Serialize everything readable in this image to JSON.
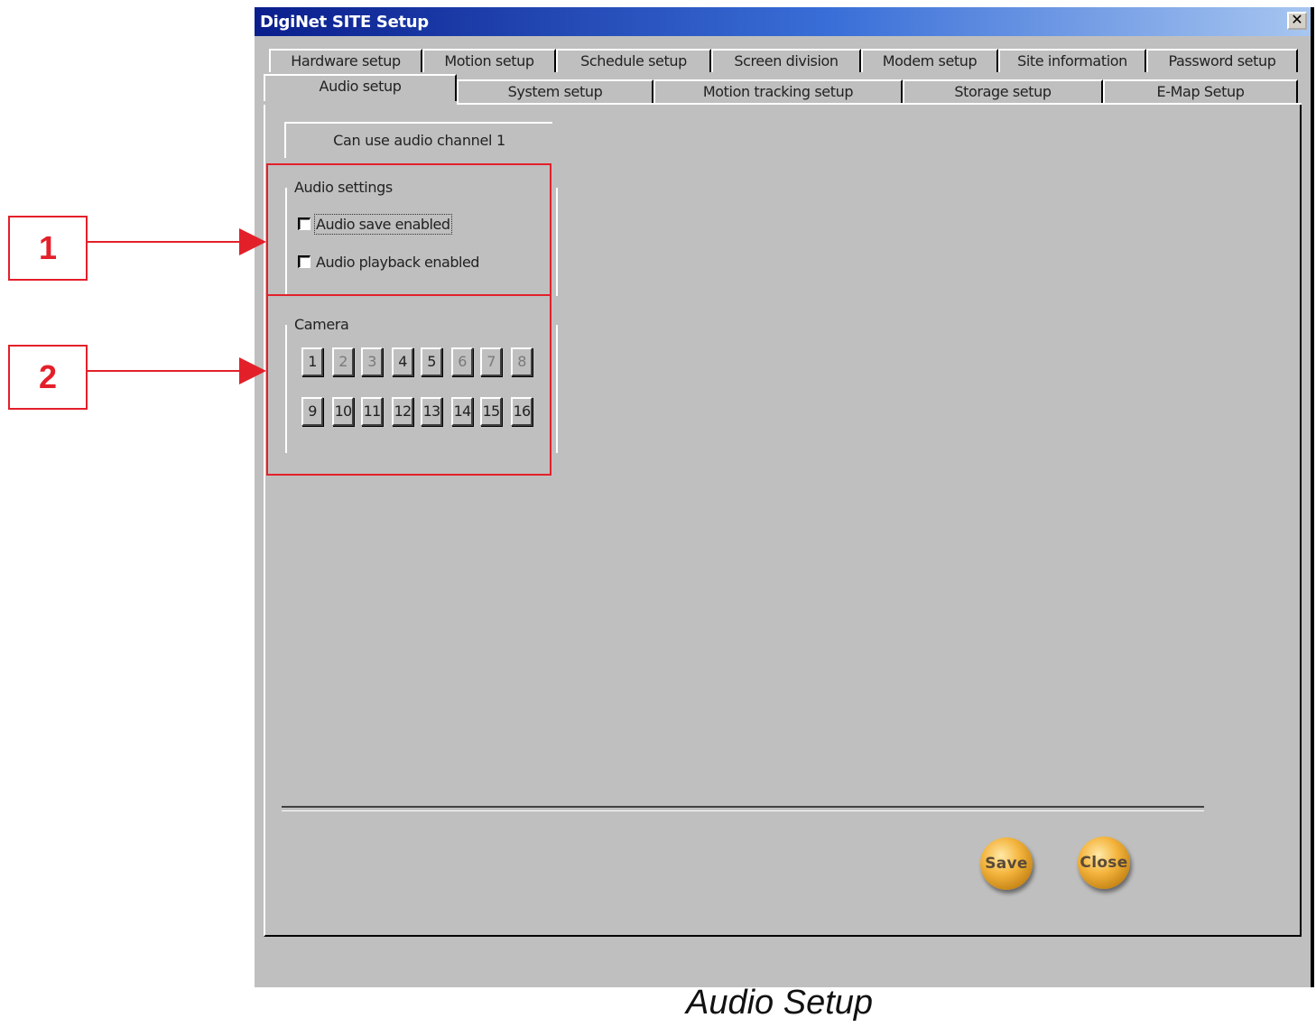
{
  "window": {
    "title": "DigiNet SITE Setup",
    "close_glyph": "✕"
  },
  "tabs_row1": [
    "Hardware setup",
    "Motion setup",
    "Schedule setup",
    "Screen division",
    "Modem setup",
    "Site information",
    "Password setup"
  ],
  "tabs_row2": [
    "Audio setup",
    "System setup",
    "Motion tracking setup",
    "Storage setup",
    "E-Map Setup"
  ],
  "active_tab": "Audio setup",
  "channel_label": "Can use audio channel 1",
  "audio_settings": {
    "title": "Audio settings",
    "options": [
      {
        "label": "Audio save enabled",
        "checked": false
      },
      {
        "label": "Audio playback enabled",
        "checked": false
      }
    ]
  },
  "camera": {
    "title": "Camera",
    "buttons": [
      "1",
      "2",
      "3",
      "4",
      "5",
      "6",
      "7",
      "8",
      "9",
      "10",
      "11",
      "12",
      "13",
      "14",
      "15",
      "16"
    ],
    "dimmed": [
      "2",
      "3",
      "6",
      "7",
      "8"
    ]
  },
  "actions": {
    "save": "Save",
    "close": "Close"
  },
  "annotations": {
    "callout_1": "1",
    "callout_2": "2",
    "color": "#e3202a"
  },
  "caption": "Audio Setup"
}
